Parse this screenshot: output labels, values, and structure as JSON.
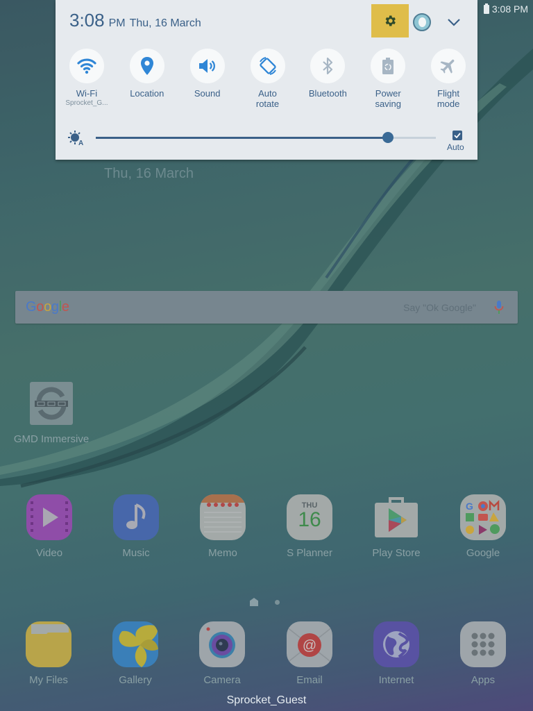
{
  "status_bar": {
    "time": "3:08 PM",
    "battery_icon": "battery-icon"
  },
  "notification_panel": {
    "time": "3:08",
    "ampm": "PM",
    "date": "Thu, 16 March",
    "settings_icon": "gear-icon",
    "user_icon": "avatar-icon",
    "expand_icon": "chevron-down-icon",
    "colors": {
      "accent": "#3a6088",
      "highlight": "#dfbd4a",
      "panel_bg": "#e6eaee"
    },
    "toggles": [
      {
        "label": "Wi-Fi",
        "sublabel": "Sprocket_G...",
        "icon": "wifi-icon",
        "active": true
      },
      {
        "label": "Location",
        "icon": "location-pin-icon",
        "active": true
      },
      {
        "label": "Sound",
        "icon": "speaker-icon",
        "active": true
      },
      {
        "label": "Auto\nrotate",
        "label_line1": "Auto",
        "label_line2": "rotate",
        "icon": "auto-rotate-icon",
        "active": true
      },
      {
        "label": "Bluetooth",
        "icon": "bluetooth-icon",
        "active": false
      },
      {
        "label": "Power\nsaving",
        "label_line1": "Power",
        "label_line2": "saving",
        "icon": "power-saving-icon",
        "active": false
      },
      {
        "label": "Flight\nmode",
        "label_line1": "Flight",
        "label_line2": "mode",
        "icon": "airplane-icon",
        "active": false
      }
    ],
    "brightness": {
      "icon": "brightness-auto-icon",
      "level": 0.86,
      "auto_checked": true,
      "auto_label": "Auto"
    }
  },
  "home": {
    "date": "Thu, 16 March",
    "search": {
      "logo": "Google",
      "hint": "Say \"Ok Google\"",
      "mic_icon": "mic-icon"
    },
    "widget_app": {
      "name": "GMD Immersive",
      "icon": "gmd-immersive-icon"
    },
    "apps_row1": [
      {
        "name": "Video",
        "icon": "video-icon"
      },
      {
        "name": "Music",
        "icon": "music-icon"
      },
      {
        "name": "Memo",
        "icon": "memo-icon"
      },
      {
        "name": "S Planner",
        "icon": "calendar-icon",
        "day": "THU",
        "date_num": "16"
      },
      {
        "name": "Play Store",
        "icon": "play-store-icon"
      },
      {
        "name": "Google",
        "icon": "google-folder-icon"
      }
    ],
    "page_indicator": {
      "pages": 2,
      "current": 0
    },
    "dock": [
      {
        "name": "My Files",
        "icon": "folder-icon"
      },
      {
        "name": "Gallery",
        "icon": "gallery-icon"
      },
      {
        "name": "Camera",
        "icon": "camera-icon"
      },
      {
        "name": "Email",
        "icon": "email-icon"
      },
      {
        "name": "Internet",
        "icon": "globe-icon"
      },
      {
        "name": "Apps",
        "icon": "apps-grid-icon"
      }
    ],
    "user_label": "Sprocket_Guest"
  }
}
